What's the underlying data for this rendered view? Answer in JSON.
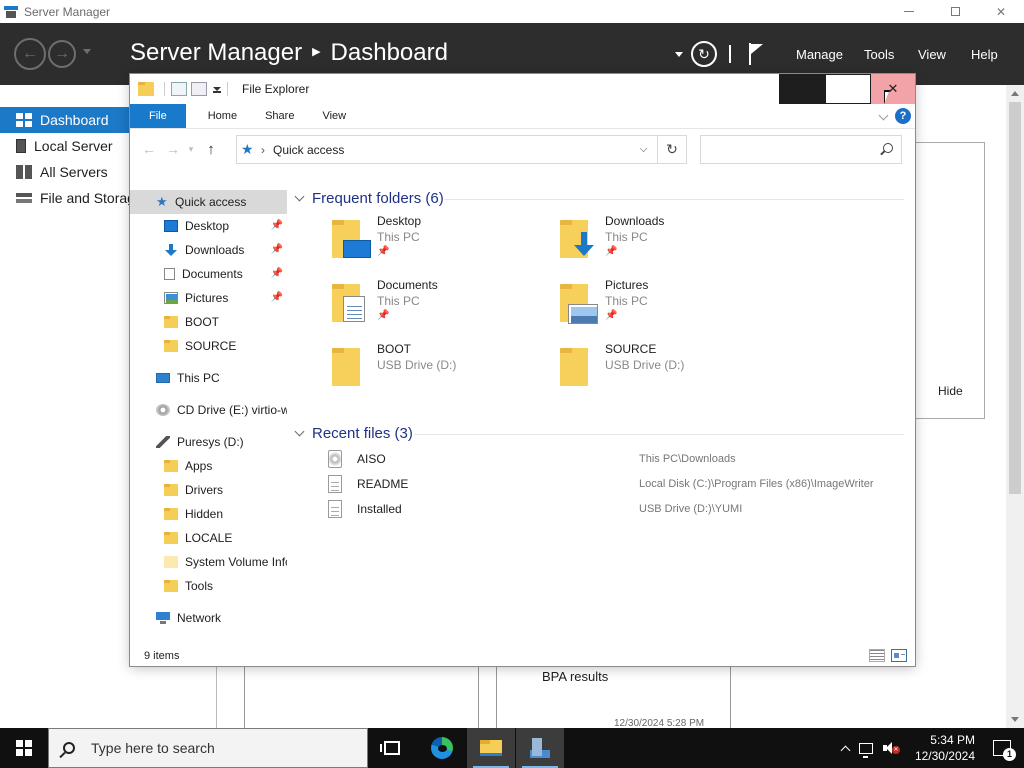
{
  "server_manager": {
    "window_title": "Server Manager",
    "breadcrumb": {
      "app": "Server Manager",
      "page": "Dashboard"
    },
    "menu": {
      "manage": "Manage",
      "tools": "Tools",
      "view": "View",
      "help": "Help"
    },
    "sidebar": {
      "items": [
        {
          "label": "Dashboard",
          "active": true
        },
        {
          "label": "Local Server",
          "active": false
        },
        {
          "label": "All Servers",
          "active": false
        },
        {
          "label": "File and Storag",
          "active": false
        }
      ]
    },
    "hide_label": "Hide",
    "bpa_label": "BPA results",
    "timestamp_partial": "12/30/2024 5:28 PM"
  },
  "explorer": {
    "title": "File Explorer",
    "ribbon_tabs": {
      "file": "File",
      "home": "Home",
      "share": "Share",
      "view": "View"
    },
    "help_glyph": "?",
    "address_path": "Quick access",
    "search_placeholder": "",
    "nav": {
      "quick_access": "Quick access",
      "pinned": [
        {
          "label": "Desktop",
          "icon": "desktop-icon"
        },
        {
          "label": "Downloads",
          "icon": "downloads-icon"
        },
        {
          "label": "Documents",
          "icon": "documents-icon"
        },
        {
          "label": "Pictures",
          "icon": "pictures-icon"
        }
      ],
      "recent_folders": [
        "BOOT",
        "SOURCE"
      ],
      "this_pc": "This PC",
      "cd_drive": "CD Drive (E:) virtio-w",
      "usb_drive": "Puresys (D:)",
      "usb_children": [
        "Apps",
        "Drivers",
        "Hidden",
        "LOCALE",
        "System Volume Infc",
        "Tools"
      ],
      "network": "Network"
    },
    "frequent_header": "Frequent folders (6)",
    "frequent": [
      {
        "name": "Desktop",
        "location": "This PC",
        "pinned": true
      },
      {
        "name": "Downloads",
        "location": "This PC",
        "pinned": true
      },
      {
        "name": "Documents",
        "location": "This PC",
        "pinned": true
      },
      {
        "name": "Pictures",
        "location": "This PC",
        "pinned": true
      },
      {
        "name": "BOOT",
        "location": "USB Drive (D:)",
        "pinned": false
      },
      {
        "name": "SOURCE",
        "location": "USB Drive (D:)",
        "pinned": false
      }
    ],
    "recent_header": "Recent files (3)",
    "recent": [
      {
        "name": "AISO",
        "path": "This PC\\Downloads",
        "icon": "iso"
      },
      {
        "name": "README",
        "path": "Local Disk (C:)\\Program Files (x86)\\ImageWriter",
        "icon": "txt"
      },
      {
        "name": "Installed",
        "path": "USB Drive (D:)\\YUMI",
        "icon": "txt"
      }
    ],
    "status_items": "9 items"
  },
  "taskbar": {
    "search_placeholder": "Type here to search",
    "time": "5:34 PM",
    "date": "12/30/2024",
    "notification_count": "1"
  },
  "colors": {
    "accent": "#1c79c8",
    "header_bg": "#2d2d2d",
    "close_hover": "#f1a3a8",
    "taskbar_bg": "#101010"
  }
}
